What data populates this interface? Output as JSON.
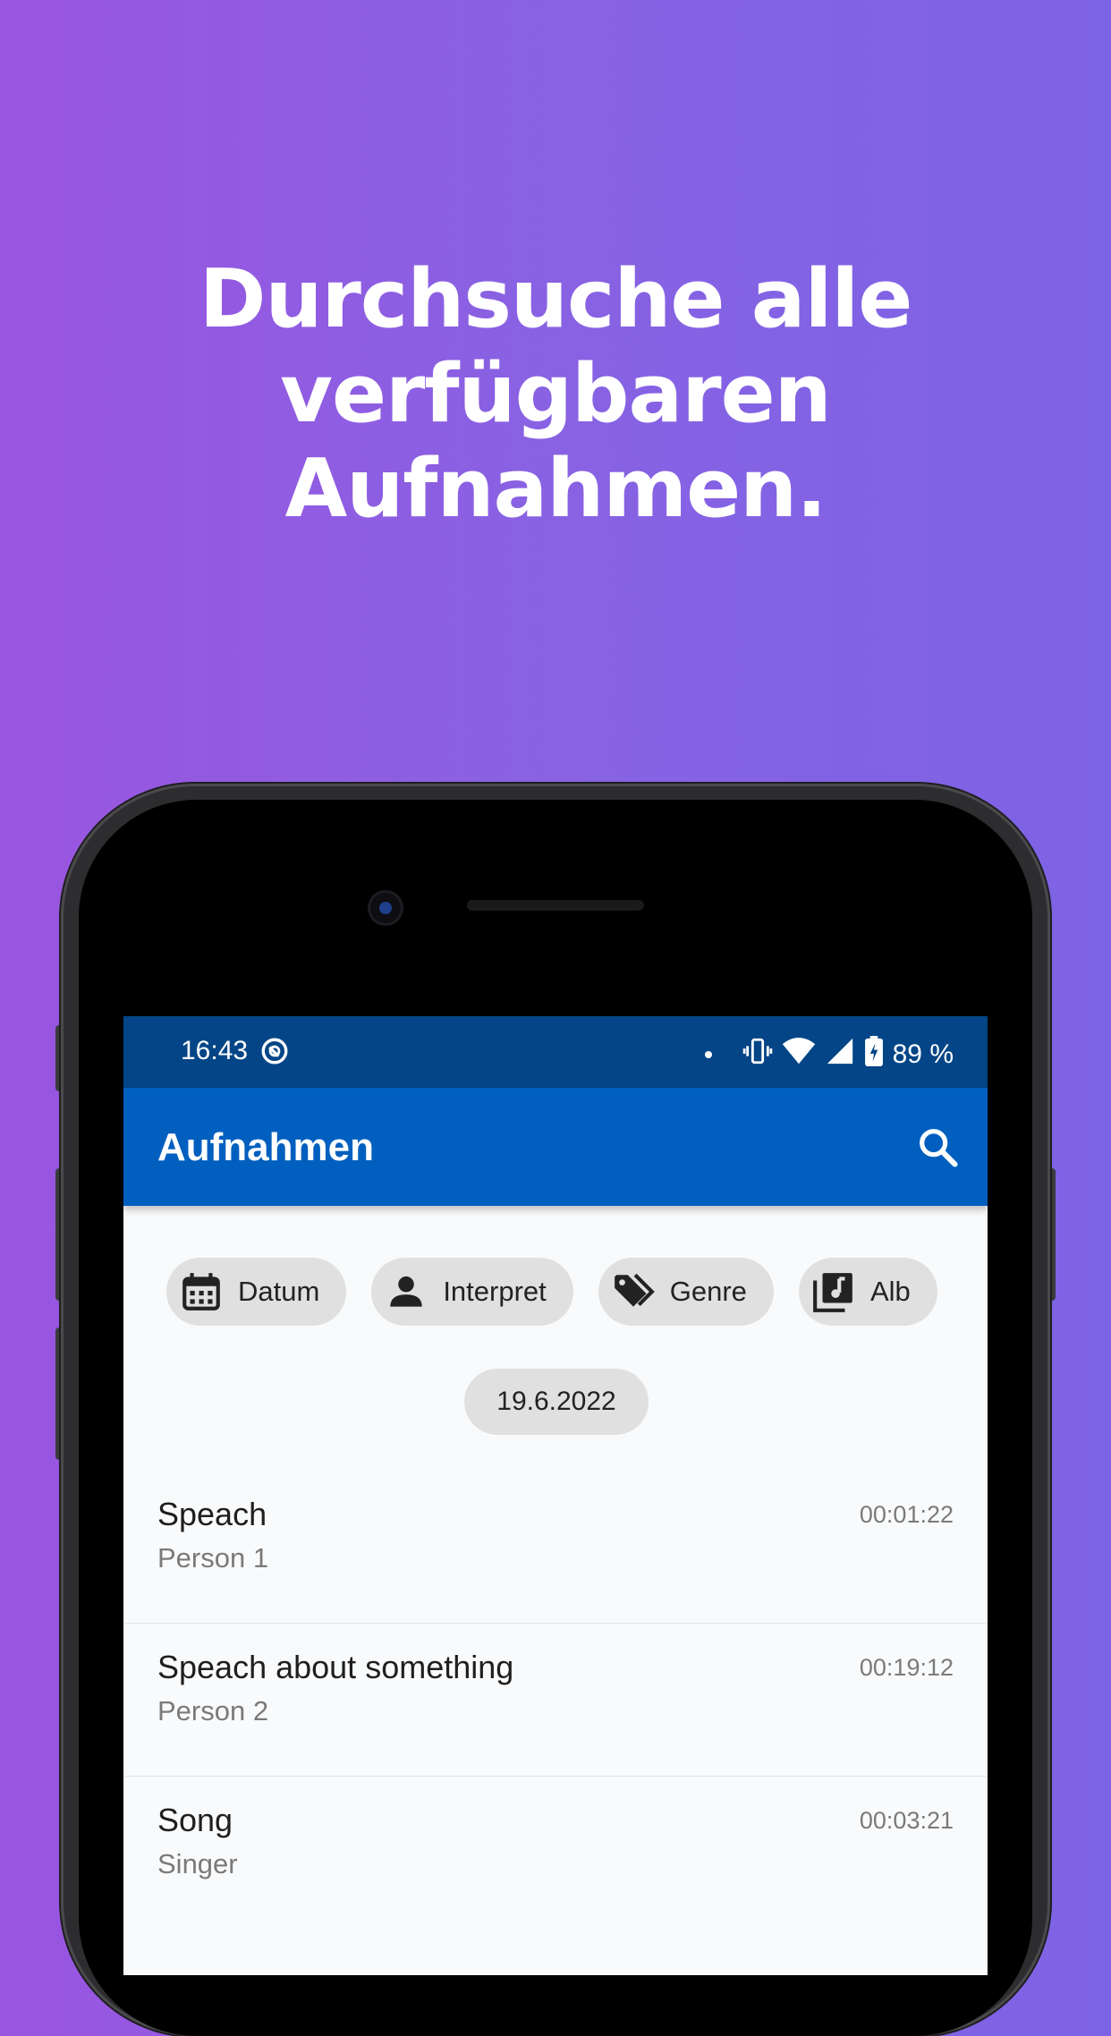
{
  "headline": [
    "Durchsuche alle",
    "verfügbaren",
    "Aufnahmen."
  ],
  "statusbar": {
    "time": "16:43",
    "battery": "89 %",
    "icons": [
      "sync-icon",
      "dot-icon",
      "vibrate-icon",
      "wifi-icon",
      "signal-icon",
      "battery-charging-icon"
    ]
  },
  "appbar": {
    "title": "Aufnahmen",
    "search_icon": "search-icon"
  },
  "filters": [
    {
      "label": "Datum",
      "icon": "calendar-icon"
    },
    {
      "label": "Interpret",
      "icon": "person-icon"
    },
    {
      "label": "Genre",
      "icon": "tag-icon"
    },
    {
      "label": "Alb",
      "icon": "album-icon"
    }
  ],
  "date_group": "19.6.2022",
  "recordings": [
    {
      "title": "Speach",
      "subtitle": "Person 1",
      "duration": "00:01:22"
    },
    {
      "title": "Speach about something",
      "subtitle": "Person 2",
      "duration": "00:19:12"
    },
    {
      "title": "Song",
      "subtitle": "Singer",
      "duration": "00:03:21"
    }
  ],
  "colors": {
    "background_left": "#9a55e0",
    "background_right": "#7d63e5",
    "statusbar": "#034586",
    "appbar": "#005fbf",
    "chip": "#e0e0e0"
  }
}
